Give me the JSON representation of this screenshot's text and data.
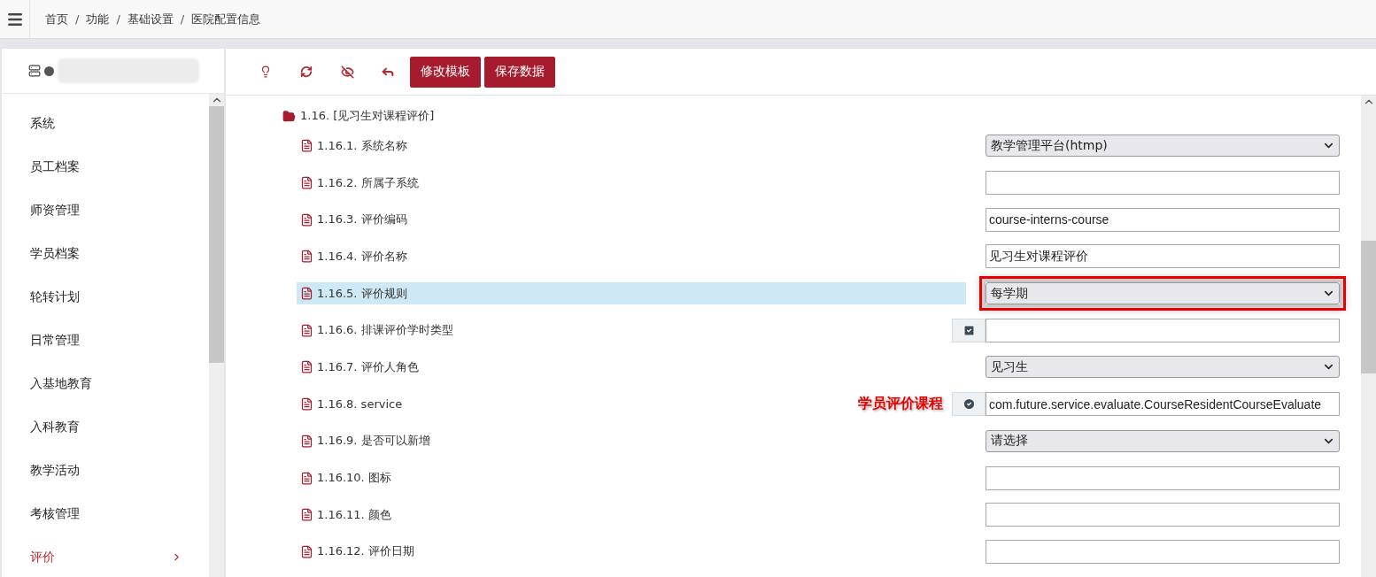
{
  "breadcrumb": {
    "separator": "/",
    "items": [
      "首页",
      "功能",
      "基础设置",
      "医院配置信息"
    ]
  },
  "sidebar": {
    "items": [
      {
        "label": "系统",
        "selected": false
      },
      {
        "label": "员工档案",
        "selected": false
      },
      {
        "label": "师资管理",
        "selected": false
      },
      {
        "label": "学员档案",
        "selected": false
      },
      {
        "label": "轮转计划",
        "selected": false
      },
      {
        "label": "日常管理",
        "selected": false
      },
      {
        "label": "入基地教育",
        "selected": false
      },
      {
        "label": "入科教育",
        "selected": false
      },
      {
        "label": "教学活动",
        "selected": false
      },
      {
        "label": "考核管理",
        "selected": false
      },
      {
        "label": "评价",
        "selected": true
      }
    ]
  },
  "toolbar": {
    "buttons": [
      "修改模板",
      "保存数据"
    ]
  },
  "tree": {
    "heading": "1.16. [见习生对课程评价]",
    "items": [
      {
        "label": "1.16.1. 系统名称",
        "kind": "select",
        "value": "教学管理平台(htmp)",
        "selected": false
      },
      {
        "label": "1.16.2. 所属子系统",
        "kind": "input",
        "selected": false
      },
      {
        "label": "1.16.3. 评价编码",
        "kind": "input",
        "value": "course-interns-course",
        "selected": false
      },
      {
        "label": "1.16.4. 评价名称",
        "kind": "input",
        "value": "见习生对课程评价",
        "selected": false
      },
      {
        "label": "1.16.5. 评价规则",
        "kind": "select",
        "value": "每学期",
        "selected": true,
        "highlighted": true
      },
      {
        "label": "1.16.6. 排课评价学时类型",
        "kind": "input",
        "addon": {
          "kind": "check"
        },
        "selected": false
      },
      {
        "label": "1.16.7. 评价人角色",
        "kind": "select",
        "value": "见习生",
        "selected": false
      },
      {
        "label": "1.16.8. service",
        "kind": "input",
        "addon": {
          "kind": "circle-check"
        },
        "value": "com.future.service.evaluate.CourseResidentCourseEvaluate",
        "note": "学员评价课程",
        "selected": false
      },
      {
        "label": "1.16.9. 是否可以新增",
        "kind": "select",
        "value": "请选择",
        "selected": false
      },
      {
        "label": "1.16.10. 图标",
        "kind": "input",
        "selected": false
      },
      {
        "label": "1.16.11. 颜色",
        "kind": "input",
        "selected": false
      },
      {
        "label": "1.16.12. 评价日期",
        "kind": "input",
        "selected": false
      }
    ]
  }
}
